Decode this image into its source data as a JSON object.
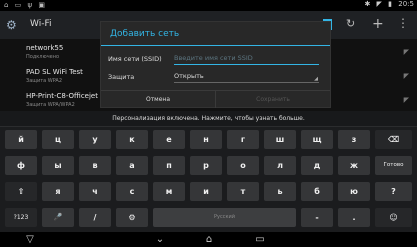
{
  "status_bar": {
    "left_icons": [
      "notification-icon",
      "download-icon",
      "usb-icon",
      "image-icon"
    ],
    "left_glyphs": "⌂ ▭ ψ ▣",
    "bluetooth_glyph": "✱",
    "wifi_glyph": "◤",
    "battery_glyph": "▮",
    "time": "20:5"
  },
  "action_bar": {
    "title": "Wi-Fi",
    "accent_color": "#33b5e5"
  },
  "networks": [
    {
      "name": "network55",
      "sub": "Подключено"
    },
    {
      "name": "PAD SL WiFi Test",
      "sub": "Защита WPA2"
    },
    {
      "name": "HP-Print-C8-Officejet P",
      "sub": "Защита WPA/WPA2"
    }
  ],
  "dialog": {
    "title": "Добавить сеть",
    "ssid_label": "Имя сети (SSID)",
    "ssid_placeholder": "Введите имя сети SSID",
    "security_label": "Защита",
    "security_value": "Открыть",
    "cancel_label": "Отмена",
    "save_label": "Сохранить"
  },
  "keyboard": {
    "suggestion": "Персонализация включена. Нажмите, чтобы узнать больше.",
    "row1": [
      "й",
      "ц",
      "у",
      "к",
      "е",
      "н",
      "г",
      "ш",
      "щ",
      "з"
    ],
    "row2": [
      "ф",
      "ы",
      "в",
      "а",
      "п",
      "р",
      "о",
      "л",
      "д",
      "ж",
      "э"
    ],
    "row3": [
      "я",
      "ч",
      "с",
      "м",
      "и",
      "т",
      "ь",
      "б",
      "ю",
      "?"
    ],
    "backspace_glyph": "⌫",
    "enter_label": "Готово",
    "shift_glyph": "⇧",
    "shift_right_glyph": "⇧",
    "sym_label": "?123",
    "mic_glyph": "🎤",
    "slash": "/",
    "settings_glyph": "⚙",
    "space_label": "Русский",
    "dash": "-",
    "period": ".",
    "smiley_glyph": "☺"
  },
  "nav": {
    "back_glyph": "▽",
    "home_glyph": "⌂",
    "recent_glyph": "▭",
    "hide_kb_glyph": "⌄"
  }
}
